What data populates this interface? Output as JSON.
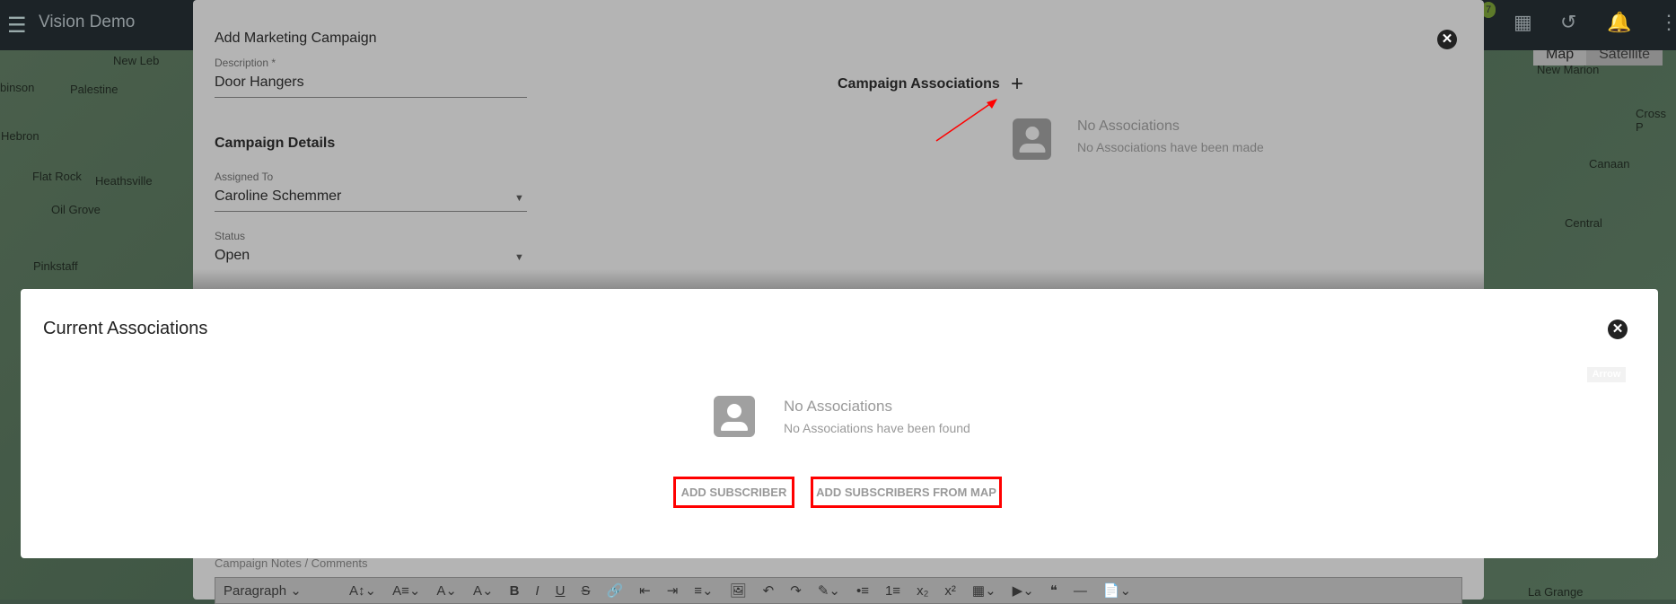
{
  "app": {
    "title": "Vision Demo",
    "badge": "7"
  },
  "map": {
    "type_buttons": [
      "Map",
      "Satellite"
    ],
    "labels": [
      "New Leb",
      "binson",
      "Palestine",
      "Hebron",
      "Flat Rock",
      "Heathsville",
      "Oil Grove",
      "Pinkstaff",
      "New Marion",
      "Cross P",
      "Canaan",
      "Central",
      "La Grange"
    ]
  },
  "campaign_dialog": {
    "title": "Add Marketing Campaign",
    "description": {
      "label": "Description *",
      "value": "Door Hangers"
    },
    "details_heading": "Campaign Details",
    "assigned_to": {
      "label": "Assigned To",
      "value": "Caroline Schemmer"
    },
    "status": {
      "label": "Status",
      "value": "Open"
    },
    "associations_heading": "Campaign Associations",
    "add_symbol": "+",
    "empty_title": "No Associations",
    "empty_text": "No Associations have been made",
    "notes_label": "Campaign Notes / Comments",
    "editor_toolbar": [
      "Paragraph ⌄",
      "A↕⌄",
      "A≡⌄",
      "A⌄",
      "A⌄",
      "B",
      "I",
      "U",
      "S",
      "🔗",
      "⇤",
      "⇥",
      "≡⌄",
      "🖼",
      "↶",
      "↷",
      "✎⌄",
      "•≡",
      "1≡",
      "x₂",
      "x²",
      "▦⌄",
      "▶⌄",
      "❝",
      "—",
      "📄⌄"
    ]
  },
  "associations_modal": {
    "title": "Current Associations",
    "empty_title": "No Associations",
    "empty_text": "No Associations have been found",
    "add_subscriber": "ADD SUBSCRIBER",
    "add_from_map": "ADD SUBSCRIBERS FROM MAP",
    "tag": "Arrow"
  },
  "colors": {
    "highlight": "#ff0000",
    "annotation_arrow": "#ff0000"
  }
}
